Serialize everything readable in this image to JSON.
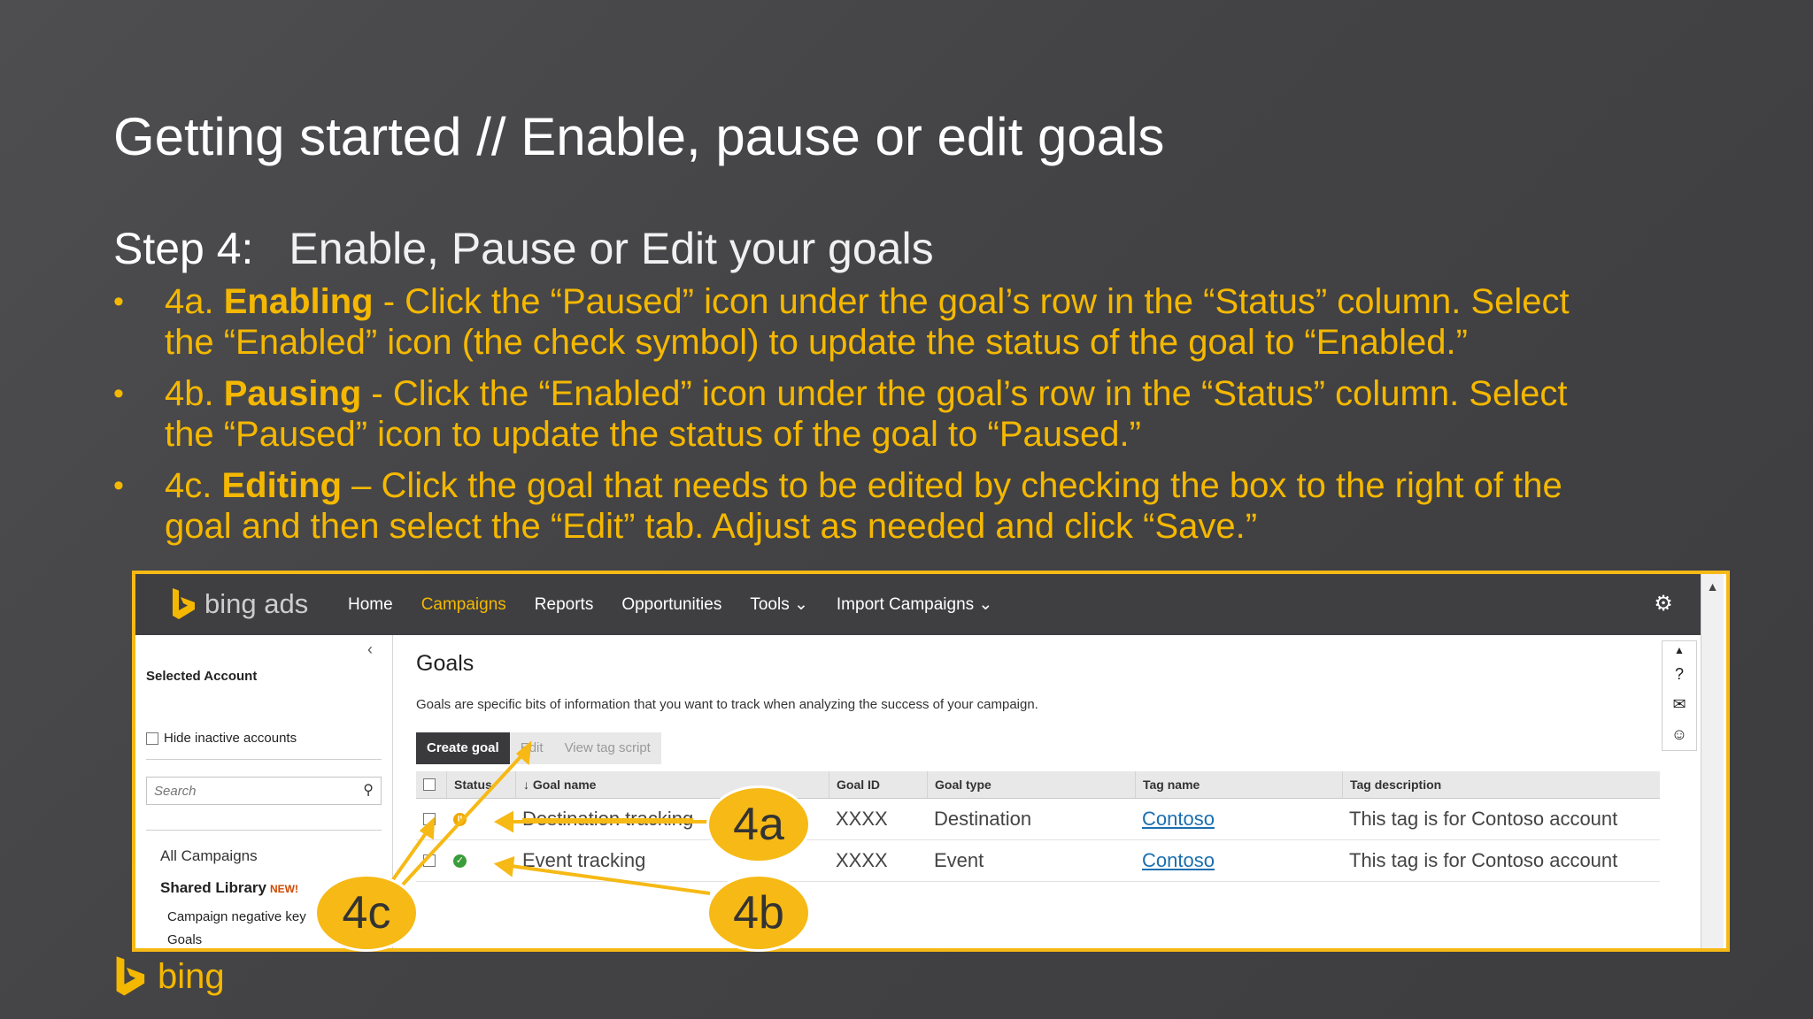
{
  "slide": {
    "title": "Getting started // Enable, pause or edit goals",
    "step_label": "Step 4:",
    "step_text": "Enable, Pause or Edit your goals",
    "bullets": [
      {
        "prefix": "4a. ",
        "keyword": "Enabling",
        "text": " -  Click the “Paused” icon under the goal’s row in the “Status” column. Select the “Enabled” icon (the check symbol) to update the status of the goal to “Enabled.”"
      },
      {
        "prefix": "4b. ",
        "keyword": "Pausing",
        "text": " - Click the “Enabled” icon under the goal’s row in the “Status” column. Select the “Paused” icon to update the status of the goal to “Paused.”"
      },
      {
        "prefix": "4c. ",
        "keyword": "Editing",
        "text": " – Click the goal that needs to be edited by checking the box to the right of the goal and then select the “Edit” tab. Adjust as needed and click “Save.”"
      }
    ],
    "brand": "bing",
    "accent_color": "#f5b800",
    "callouts": {
      "a": "4a",
      "b": "4b",
      "c": "4c"
    }
  },
  "app": {
    "logo_text": "bing ads",
    "nav": [
      "Home",
      "Campaigns",
      "Reports",
      "Opportunities",
      "Tools",
      "Import Campaigns"
    ],
    "active_nav": "Campaigns",
    "chevron": "⌄",
    "sidebar": {
      "title": "Selected Account",
      "hide_inactive": "Hide inactive accounts",
      "search_placeholder": "Search",
      "all_campaigns": "All Campaigns",
      "shared_library": "Shared Library",
      "new_badge": "NEW!",
      "sub_items": [
        "Campaign negative key",
        "Goals"
      ]
    },
    "main": {
      "title": "Goals",
      "description": "Goals are specific bits of information that you want to track when analyzing the success of your campaign.",
      "tabs": [
        "Create goal",
        "Edit",
        "View tag script"
      ],
      "columns": [
        "Status",
        "Goal name",
        "Goal ID",
        "Goal type",
        "Tag name",
        "Tag description"
      ],
      "sort_indicator": "↓",
      "rows": [
        {
          "status": "paused",
          "goal_name": "Destination tracking",
          "goal_id": "XXXX",
          "goal_type": "Destination",
          "tag_name": "Contoso",
          "tag_description": "This tag is for Contoso account"
        },
        {
          "status": "enabled",
          "goal_name": "Event tracking",
          "goal_id": "XXXX",
          "goal_type": "Event",
          "tag_name": "Contoso",
          "tag_description": "This tag is for Contoso account"
        }
      ]
    }
  }
}
